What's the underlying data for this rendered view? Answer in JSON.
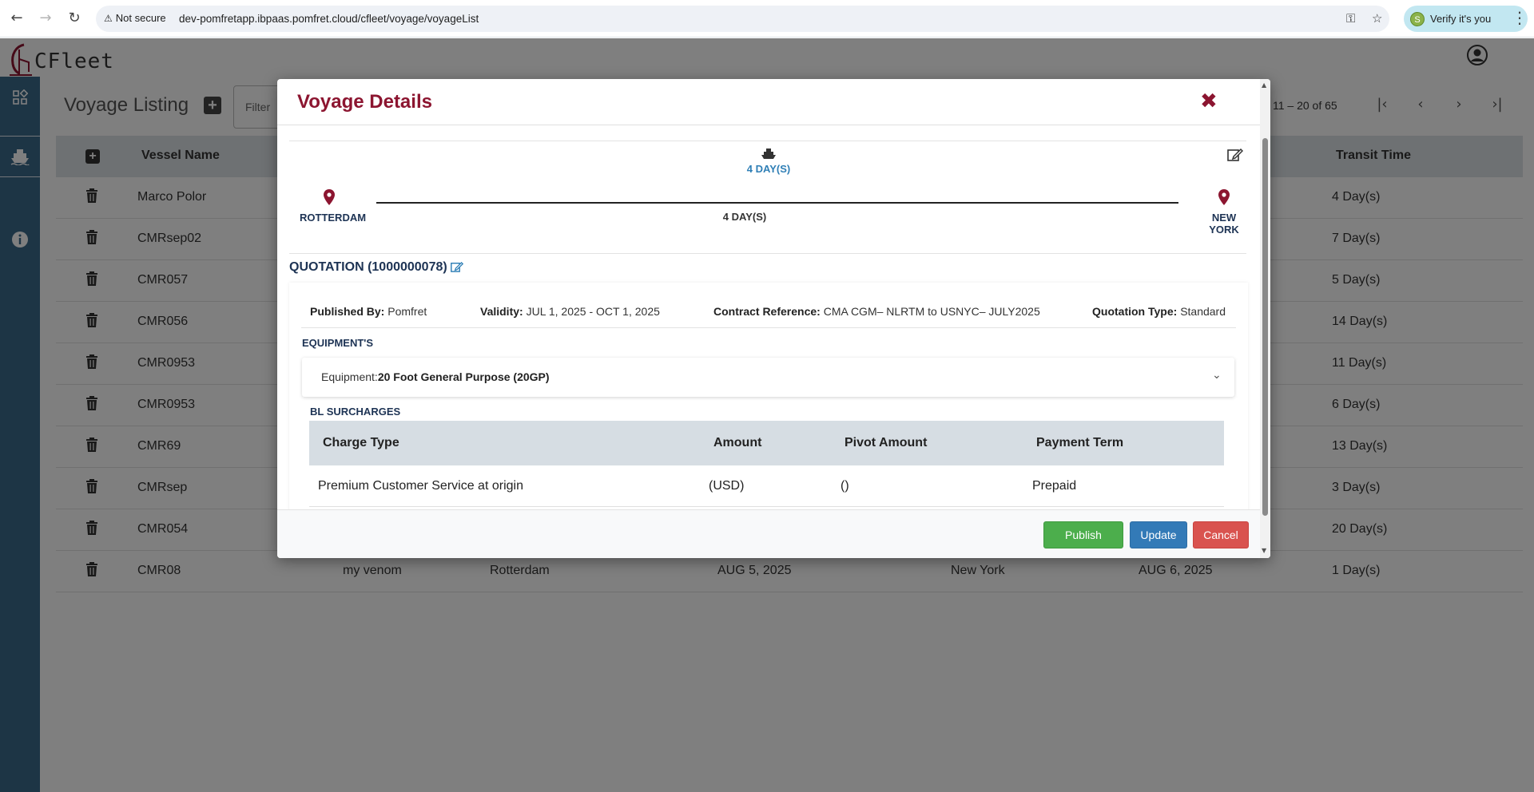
{
  "browser": {
    "security_label": "Not secure",
    "url": "dev-pomfretapp.ibpaas.pomfret.cloud/cfleet/voyage/voyageList",
    "verify_label": "Verify it's you"
  },
  "app": {
    "logo_text": "CFleet",
    "page_title": "Voyage Listing",
    "filter_placeholder": "Filter",
    "pager_info": "11 – 20 of 65"
  },
  "table": {
    "columns": [
      "Vessel Name",
      "Transit Time"
    ],
    "rows": [
      {
        "vessel": "Marco Polor",
        "transit": "4 Day(s)"
      },
      {
        "vessel": "CMRsep02",
        "transit": "7 Day(s)"
      },
      {
        "vessel": "CMR057",
        "transit": "5 Day(s)"
      },
      {
        "vessel": "CMR056",
        "transit": "14 Day(s)"
      },
      {
        "vessel": "CMR0953",
        "transit": "11 Day(s)"
      },
      {
        "vessel": "CMR0953",
        "transit": "6 Day(s)"
      },
      {
        "vessel": "CMR69",
        "transit": "13 Day(s)"
      },
      {
        "vessel": "CMRsep",
        "transit": "3 Day(s)"
      },
      {
        "vessel": "CMR054",
        "transit": "20 Day(s)"
      },
      {
        "vessel": "CMR08",
        "voyage": "my venom",
        "origin": "Rotterdam",
        "departure": "AUG 5, 2025",
        "destination": "New York",
        "arrival": "AUG 6, 2025",
        "transit": "1 Day(s)"
      }
    ]
  },
  "modal": {
    "title": "Voyage Details",
    "route": {
      "days_top": "4 DAY(S)",
      "days_mid": "4 DAY(S)",
      "origin": "ROTTERDAM",
      "destination_line1": "NEW",
      "destination_line2": "YORK"
    },
    "quotation": {
      "header": "QUOTATION (1000000078)",
      "published_by_label": "Published By:",
      "published_by": "Pomfret",
      "validity_label": "Validity:",
      "validity": "JUL 1, 2025 - OCT 1, 2025",
      "contract_ref_label": "Contract Reference:",
      "contract_ref": "CMA CGM– NLRTM to USNYC– JULY2025",
      "type_label": "Quotation Type:",
      "type": "Standard"
    },
    "equipment": {
      "section_label": "EQUIPMENT'S",
      "label": "Equipment:",
      "value": "20 Foot General Purpose (20GP)"
    },
    "surcharges": {
      "section_label": "BL SURCHARGES",
      "columns": [
        "Charge Type",
        "Amount",
        "Pivot Amount",
        "Payment Term"
      ],
      "rows": [
        {
          "charge_type": "Premium Customer Service at origin",
          "amount": "(USD)",
          "pivot": "()",
          "term": "Prepaid"
        }
      ]
    },
    "buttons": {
      "publish": "Publish",
      "update": "Update",
      "cancel": "Cancel"
    }
  },
  "colors": {
    "accent": "#8c1530",
    "sidebar": "#3b6a8a",
    "publish": "#4cae4c",
    "update": "#337ab7",
    "cancel": "#d9534f"
  }
}
